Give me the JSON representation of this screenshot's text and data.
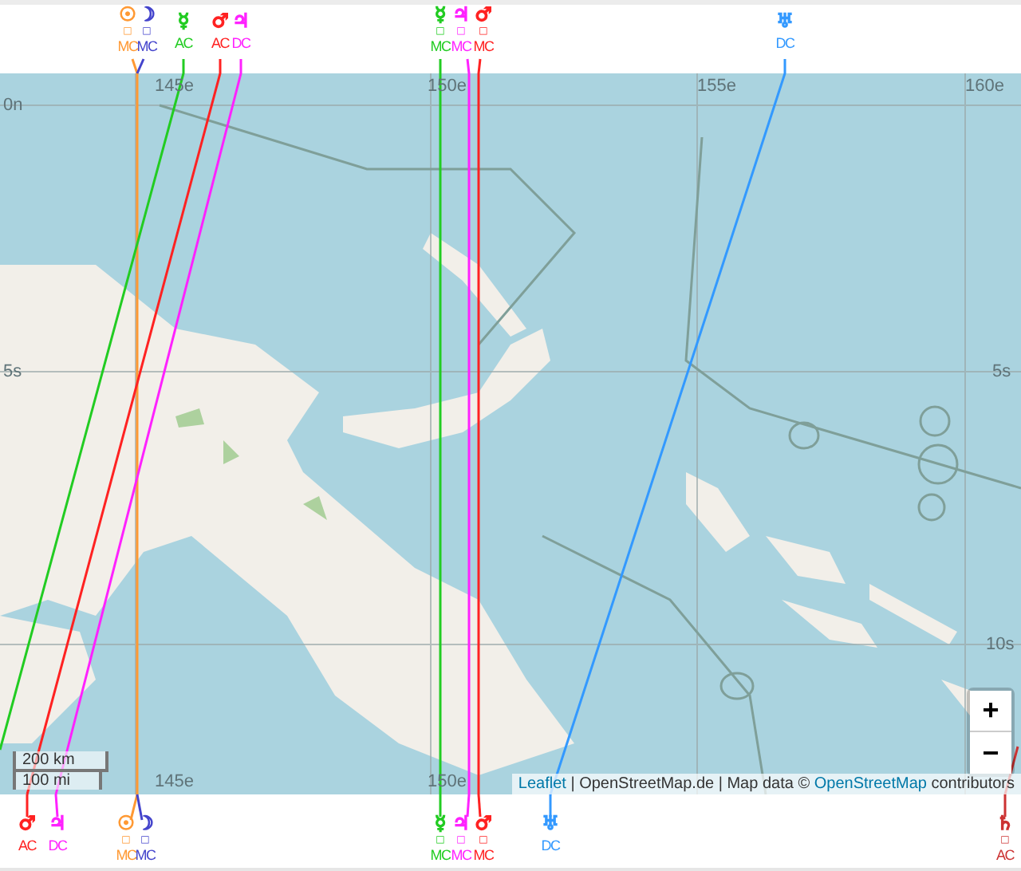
{
  "top_labels": [
    {
      "glyph": "☉",
      "mark": "□",
      "angle": "MC",
      "color": "#ff9933"
    },
    {
      "glyph": "☽",
      "mark": "□",
      "angle": "MC",
      "color": "#4444cc"
    },
    {
      "glyph": "☿",
      "angle": "AC",
      "color": "#22cc22"
    },
    {
      "glyph": "♂",
      "angle": "AC",
      "color": "#ff2222"
    },
    {
      "glyph": "♃",
      "angle": "DC",
      "color": "#ff22ff"
    },
    {
      "glyph": "☿",
      "mark": "□",
      "angle": "MC",
      "color": "#22cc22"
    },
    {
      "glyph": "♃",
      "mark": "□",
      "angle": "MC",
      "color": "#ff22ff"
    },
    {
      "glyph": "♂",
      "mark": "□",
      "angle": "MC",
      "color": "#ff2222"
    },
    {
      "glyph": "♅",
      "angle": "DC",
      "color": "#3399ff"
    }
  ],
  "map": {
    "graticule_labels": [
      "145e",
      "150e",
      "155e",
      "160e",
      "0n",
      "5s",
      "5s",
      "10s",
      "145e",
      "150e"
    ],
    "scale": [
      "200 km",
      "100 mi"
    ],
    "zoom_in": "+",
    "zoom_out": "−",
    "attribution": {
      "link_1": "Leaflet",
      "text_1": " | OpenStreetMap.de | Map data © ",
      "link_2": "OpenStreetMap",
      "text_2": " contributors"
    }
  },
  "bottom_labels": [
    {
      "glyph": "♂",
      "angle": "AC",
      "color": "#ff2222"
    },
    {
      "glyph": "♃",
      "angle": "DC",
      "color": "#ff22ff"
    },
    {
      "glyph": "☉",
      "mark": "□",
      "angle": "MC",
      "color": "#ff9933"
    },
    {
      "glyph": "☽",
      "mark": "□",
      "angle": "MC",
      "color": "#4444cc"
    },
    {
      "glyph": "☿",
      "mark": "□",
      "angle": "MC",
      "color": "#22cc22"
    },
    {
      "glyph": "♃",
      "mark": "□",
      "angle": "MC",
      "color": "#ff22ff"
    },
    {
      "glyph": "♂",
      "mark": "□",
      "angle": "MC",
      "color": "#ff2222"
    },
    {
      "glyph": "♅",
      "angle": "DC",
      "color": "#3399ff"
    },
    {
      "glyph": "♄",
      "mark": "□",
      "angle": "AC",
      "color": "#cc3333"
    }
  ]
}
